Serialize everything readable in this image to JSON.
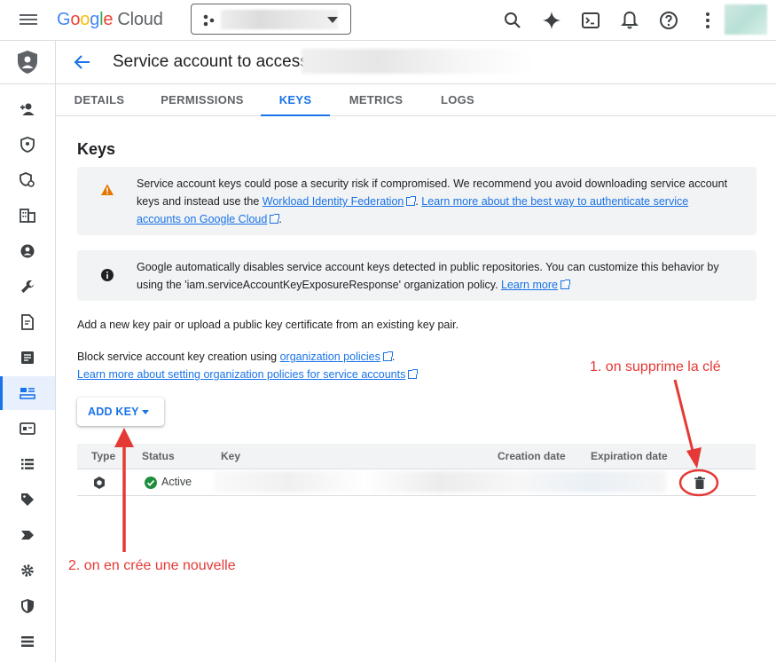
{
  "topbar": {
    "logo_google": [
      "G",
      "o",
      "o",
      "g",
      "l",
      "e"
    ],
    "logo_cloud": "Cloud",
    "icons": [
      "search-icon",
      "gemini-icon",
      "terminal-icon",
      "bell-icon",
      "help-icon",
      "more-vert-icon"
    ]
  },
  "header": {
    "title": "Service account to access"
  },
  "tabs": [
    {
      "label": "DETAILS",
      "active": false
    },
    {
      "label": "PERMISSIONS",
      "active": false
    },
    {
      "label": "KEYS",
      "active": true
    },
    {
      "label": "METRICS",
      "active": false
    },
    {
      "label": "LOGS",
      "active": false
    }
  ],
  "page": {
    "heading": "Keys",
    "warning": {
      "text_1": "Service account keys could pose a security risk if compromised. We recommend you avoid downloading service account keys and instead use the ",
      "link_1": "Workload Identity Federation",
      "text_2": ". ",
      "link_2": "Learn more about the best way to authenticate service accounts on Google Cloud",
      "text_3": "."
    },
    "info": {
      "text_1": "Google automatically disables service account keys detected in public repositories. You can customize this behavior by using the 'iam.serviceAccountKeyExposureResponse' organization policy. ",
      "link_1": "Learn more"
    },
    "add_key_text": "Add a new key pair or upload a public key certificate from an existing key pair.",
    "block_text": "Block service account key creation using ",
    "block_link": "organization policies",
    "block_text_end": ".",
    "learn_more_link": "Learn more about setting organization policies for service accounts",
    "add_key_button": "ADD KEY"
  },
  "table": {
    "columns": [
      "Type",
      "Status",
      "Key",
      "Creation date",
      "Expiration date"
    ],
    "rows": [
      {
        "status": "Active"
      }
    ]
  },
  "annotations": {
    "note_1": "1. on supprime la clé",
    "note_2": "2. on en crée une nouvelle",
    "color": "#e53935"
  },
  "colors": {
    "accent": "#1a73e8",
    "warning": "#e37400",
    "success": "#1e8e3e"
  }
}
